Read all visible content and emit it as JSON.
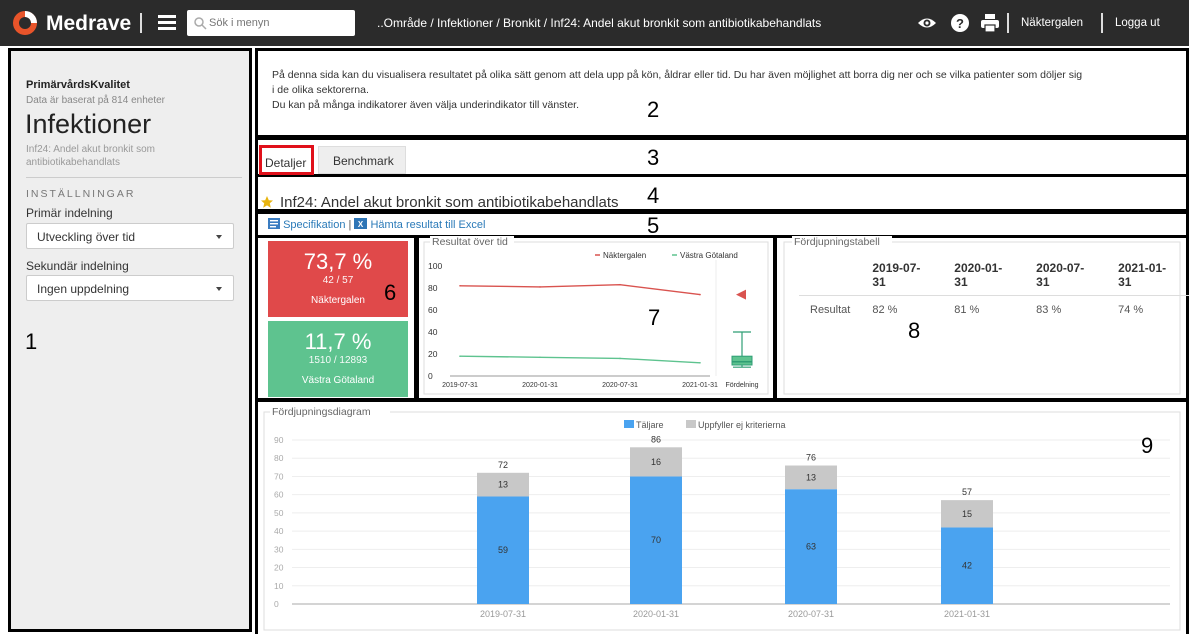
{
  "topbar": {
    "brand": "Medrave",
    "search_placeholder": "Sök i menyn",
    "breadcrumb": "..Område / Infektioner / Bronkit / Inf24: Andel akut bronkit som antibiotikabehandlats",
    "user": "Näktergalen",
    "logout": "Logga ut",
    "icons": [
      "eye-icon",
      "help-icon",
      "print-icon"
    ]
  },
  "sidebar": {
    "title": "PrimärvårdsKvalitet",
    "subtitle": "Data är baserat på 814 enheter",
    "heading": "Infektioner",
    "description": "Inf24: Andel akut bronkit som antibiotikabehandlats",
    "settings_label": "INSTÄLLNINGAR",
    "primary_label": "Primär indelning",
    "primary_value": "Utveckling över tid",
    "secondary_label": "Sekundär indelning",
    "secondary_value": "Ingen uppdelning"
  },
  "regions": [
    "1",
    "2",
    "3",
    "4",
    "5",
    "6",
    "7",
    "8",
    "9"
  ],
  "intro": {
    "line1": "På denna sida kan du visualisera resultatet på olika sätt genom att dela upp på kön, åldrar eller tid. Du har även möjlighet att borra dig ner och se vilka patienter som döljer sig",
    "line2": "i de olika sektorerna.",
    "line3": "Du kan på många indikatorer även välja underindikator till vänster."
  },
  "tabs": {
    "details": "Detaljer",
    "benchmark": "Benchmark"
  },
  "indicator": {
    "title": "Inf24: Andel akut bronkit som antibiotikabehandlats"
  },
  "links": {
    "spec": "Specifikation",
    "sep": "|",
    "excel": "Hämta resultat till Excel"
  },
  "cards": {
    "red": {
      "pct": "73,7 %",
      "count": "42 / 57",
      "unit": "Näktergalen",
      "color": "#e0494a"
    },
    "green": {
      "pct": "11,7 %",
      "count": "1510 / 12893",
      "unit": "Västra Götaland",
      "color": "#5ec38f"
    }
  },
  "trend": {
    "title": "Resultat över tid",
    "legend": [
      "Näktergalen",
      "Västra Götaland"
    ],
    "y_ticks": [
      "100",
      "80",
      "60",
      "40",
      "20",
      "0"
    ],
    "x_ticks": [
      "2019-07-31",
      "2020-01-31",
      "2020-07-31",
      "2021-01-31"
    ],
    "dist_label": "Fördelning"
  },
  "table": {
    "title": "Fördjupningstabell",
    "columns": [
      "2019-07-31",
      "2020-01-31",
      "2020-07-31",
      "2021-01-31"
    ],
    "row_label": "Resultat",
    "row_values": [
      "82 %",
      "81 %",
      "83 %",
      "74 %"
    ]
  },
  "chart_data": [
    {
      "type": "line",
      "title": "Resultat över tid",
      "x": [
        "2019-07-31",
        "2020-01-31",
        "2020-07-31",
        "2021-01-31"
      ],
      "ylim": [
        0,
        100
      ],
      "series": [
        {
          "name": "Näktergalen",
          "color": "#d9534f",
          "values": [
            82,
            81,
            83,
            74
          ]
        },
        {
          "name": "Västra Götaland",
          "color": "#5ec38f",
          "values": [
            18,
            17,
            16,
            12
          ]
        }
      ],
      "legend_position": "top-right"
    },
    {
      "type": "bar",
      "title": "Fördjupningsdiagram",
      "categories": [
        "2019-07-31",
        "2020-01-31",
        "2020-07-31",
        "2021-01-31"
      ],
      "series": [
        {
          "name": "Täljare",
          "color": "#4aa3f0",
          "values": [
            59,
            70,
            63,
            42
          ]
        },
        {
          "name": "Uppfyller ej kriterierna",
          "color": "#c8c8c8",
          "values": [
            13,
            16,
            13,
            15
          ]
        }
      ],
      "totals": [
        72,
        86,
        76,
        57
      ],
      "stacked": true,
      "ylim": [
        0,
        90
      ],
      "y_ticks": [
        "90",
        "80",
        "70",
        "60",
        "50",
        "40",
        "30",
        "20",
        "10",
        "0"
      ],
      "legend_position": "top-center"
    }
  ]
}
